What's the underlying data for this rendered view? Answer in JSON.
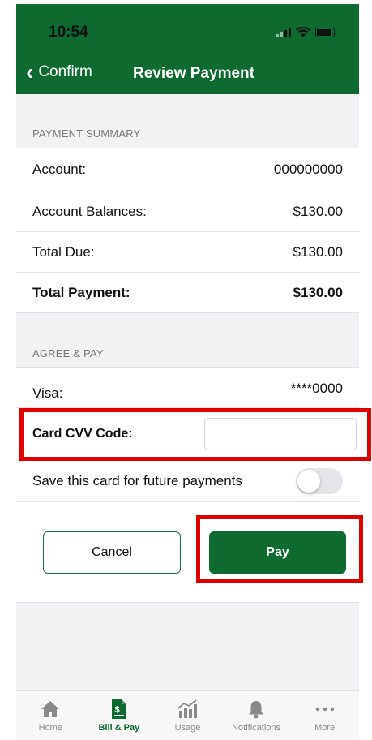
{
  "status_bar": {
    "time": "10:54"
  },
  "header": {
    "back_label": "Confirm",
    "title": "Review Payment"
  },
  "payment_summary": {
    "section_label": "PAYMENT SUMMARY",
    "rows": [
      {
        "label": "Account:",
        "value": "000000000"
      },
      {
        "label": "Account Balances:",
        "value": "$130.00"
      },
      {
        "label": "Total Due:",
        "value": "$130.00"
      },
      {
        "label": "Total Payment:",
        "value": "$130.00"
      }
    ]
  },
  "agree_pay": {
    "section_label": "AGREE & PAY",
    "card_label": "Visa:",
    "card_value": "****0000",
    "cvv_label": "Card CVV Code:",
    "cvv_value": "",
    "save_card_label": "Save this card for future payments",
    "save_card_enabled": false
  },
  "actions": {
    "cancel_label": "Cancel",
    "pay_label": "Pay"
  },
  "tabbar": {
    "items": [
      {
        "label": "Home",
        "icon": "home-icon",
        "active": false
      },
      {
        "label": "Bill & Pay",
        "icon": "bill-icon",
        "active": true
      },
      {
        "label": "Usage",
        "icon": "usage-chart-icon",
        "active": false
      },
      {
        "label": "Notifications",
        "icon": "bell-icon",
        "active": false
      },
      {
        "label": "More",
        "icon": "more-icon",
        "active": false
      }
    ]
  },
  "colors": {
    "brand_green": "#0e6a2f",
    "highlight_red": "#e00000"
  }
}
